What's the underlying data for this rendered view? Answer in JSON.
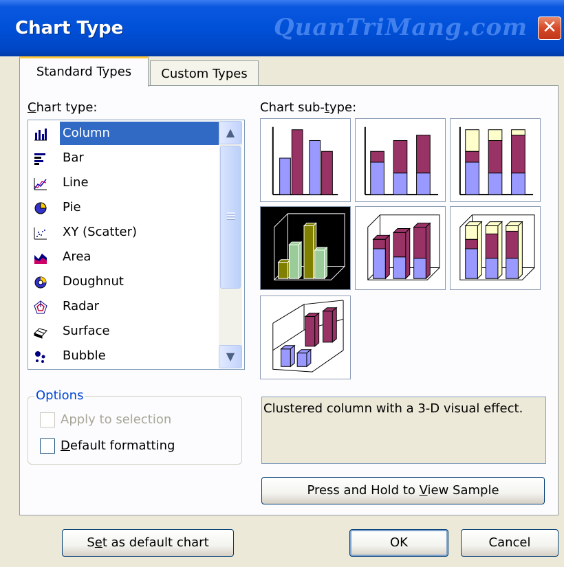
{
  "window": {
    "title": "Chart Type",
    "watermark": "QuanTriMang.com",
    "close_glyph": "✕"
  },
  "tabs": [
    {
      "label": "Standard Types",
      "active": true
    },
    {
      "label": "Custom Types",
      "active": false
    }
  ],
  "chart_type": {
    "label_pre": "",
    "label_key": "C",
    "label_post": "hart type:",
    "items": [
      {
        "label": "Column",
        "icon": "column-chart-icon",
        "selected": true
      },
      {
        "label": "Bar",
        "icon": "bar-chart-icon"
      },
      {
        "label": "Line",
        "icon": "line-chart-icon"
      },
      {
        "label": "Pie",
        "icon": "pie-chart-icon"
      },
      {
        "label": "XY (Scatter)",
        "icon": "scatter-chart-icon"
      },
      {
        "label": "Area",
        "icon": "area-chart-icon"
      },
      {
        "label": "Doughnut",
        "icon": "doughnut-chart-icon"
      },
      {
        "label": "Radar",
        "icon": "radar-chart-icon"
      },
      {
        "label": "Surface",
        "icon": "surface-chart-icon"
      },
      {
        "label": "Bubble",
        "icon": "bubble-chart-icon"
      }
    ],
    "scroll_up_glyph": "▲",
    "scroll_down_glyph": "▼"
  },
  "sub_type": {
    "label_pre": "Chart sub-",
    "label_key": "t",
    "label_post": "ype:",
    "cells": [
      "clustered-column",
      "stacked-column",
      "100-stacked-column",
      "clustered-column-3d-effect",
      "stacked-column-3d-effect",
      "100-stacked-column-3d-effect",
      "3d-column"
    ],
    "selected_index": 3,
    "description": "Clustered column with a 3-D visual effect."
  },
  "options": {
    "legend": "Options",
    "apply_to_selection": {
      "label": "Apply to selection",
      "checked": false,
      "disabled": true
    },
    "default_formatting": {
      "label_key": "D",
      "label_post": "efault formatting",
      "checked": false
    }
  },
  "buttons": {
    "view_sample": {
      "pre": "Press and Hold to ",
      "key": "V",
      "post": "iew Sample"
    },
    "set_default": {
      "pre": "S",
      "key": "e",
      "post": "t as default chart"
    },
    "ok": "OK",
    "cancel": "Cancel"
  },
  "colors": {
    "title_bar": "#0050d8",
    "selection": "#316ac5",
    "series_1": "#9999ff",
    "series_2": "#993366",
    "series_3": "#ffffcc",
    "selected_series_1": "#99cc99",
    "selected_series_2": "#808000"
  }
}
